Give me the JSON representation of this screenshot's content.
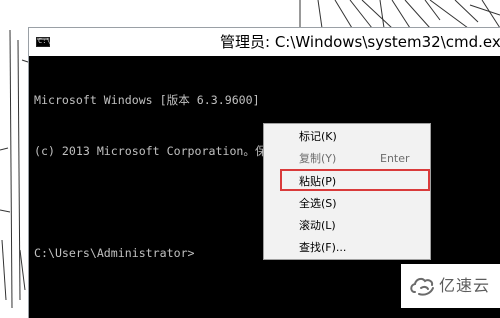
{
  "window": {
    "title": "管理员: C:\\Windows\\system32\\cmd.exe",
    "icon": "cmd-icon",
    "icon_prompt": "C:\\",
    "background": "#000000",
    "text_color": "#c0c0c0"
  },
  "console": {
    "lines": [
      "Microsoft Windows [版本 6.3.9600]",
      "(c) 2013 Microsoft Corporation。保留所有权利。",
      "",
      "C:\\Users\\Administrator>"
    ]
  },
  "context_menu": {
    "items": [
      {
        "label": "标记(K)",
        "shortcut": "",
        "enabled": true
      },
      {
        "label": "复制(Y)",
        "shortcut": "Enter",
        "enabled": false
      },
      {
        "label": "粘贴(P)",
        "shortcut": "",
        "enabled": true,
        "highlighted": true
      },
      {
        "label": "全选(S)",
        "shortcut": "",
        "enabled": true
      },
      {
        "label": "滚动(L)",
        "shortcut": "",
        "enabled": true
      },
      {
        "label": "查找(F)...",
        "shortcut": "",
        "enabled": true
      }
    ],
    "highlight_color": "#d93a3a"
  },
  "watermark": {
    "text": "亿速云",
    "icon": "cloud-logo-icon"
  }
}
